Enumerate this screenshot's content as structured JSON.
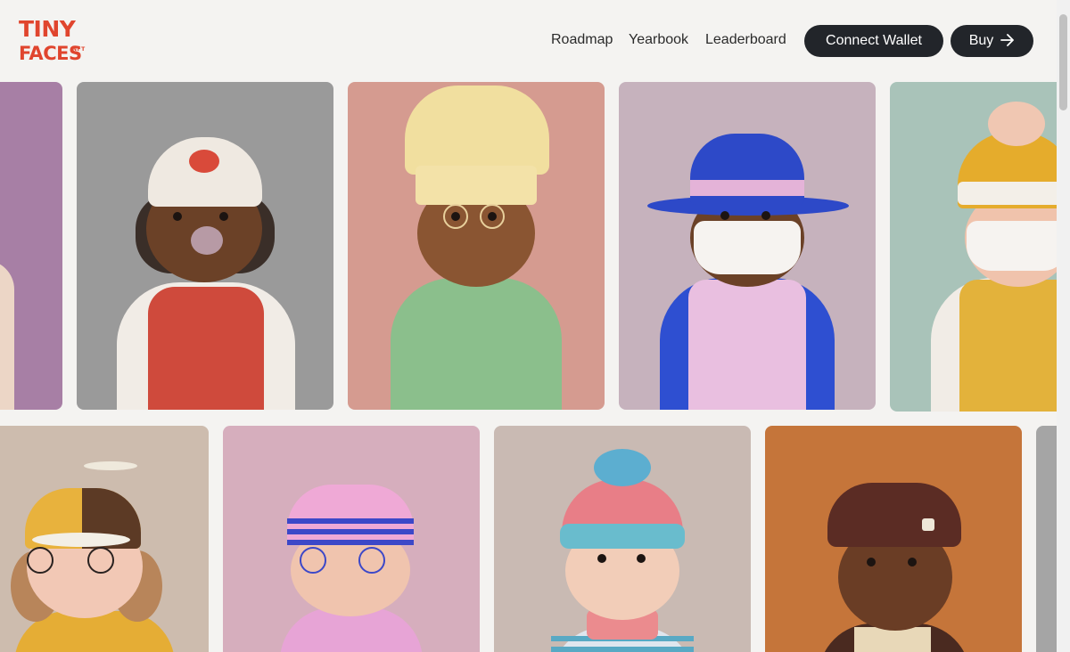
{
  "logo": {
    "line1": "TINY",
    "line2": "FACES",
    "sup": "NFT",
    "color": "#e0452e"
  },
  "nav": {
    "links": [
      "Roadmap",
      "Yearbook",
      "Leaderboard"
    ],
    "connect_label": "Connect Wallet",
    "buy_label": "Buy",
    "buy_icon": "arrow-right-icon"
  },
  "gallery": {
    "row1": [
      {
        "name": "partial-character-purple",
        "bg": "#a77fa5"
      },
      {
        "name": "character-red-vest-cap",
        "bg": "#9a9a9a"
      },
      {
        "name": "character-chef-hat",
        "bg": "#d59b90"
      },
      {
        "name": "character-blue-hat-mask",
        "bg": "#c6b2bd"
      },
      {
        "name": "character-yellow-beanie",
        "bg": "#a9c3b9"
      }
    ],
    "row2": [
      {
        "name": "character-propeller-cap",
        "bg": "#cdbcae"
      },
      {
        "name": "character-sailor-hat",
        "bg": "#d6aebd"
      },
      {
        "name": "character-pink-beanie",
        "bg": "#c9bab3"
      },
      {
        "name": "character-brown-cap",
        "bg": "#c5753a"
      },
      {
        "name": "partial-character-grey",
        "bg": "#a5a5a5"
      }
    ]
  }
}
